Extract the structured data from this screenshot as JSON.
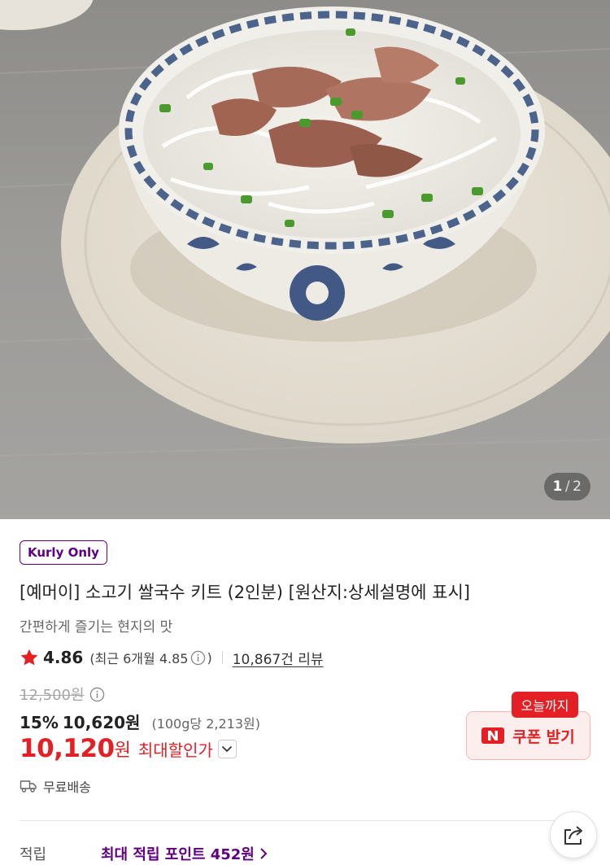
{
  "image_pager": {
    "current": "1",
    "separator": "/",
    "total": "2"
  },
  "product": {
    "badge": "Kurly Only",
    "title": "[예머이] 소고기 쌀국수 키트 (2인분) [원산지:상세설명에 표시]",
    "subtitle": "간편하게 즐기는 현지의 맛"
  },
  "rating": {
    "score": "4.86",
    "recent_prefix": "(최근 6개월 4.85",
    "recent_suffix": ")",
    "review_count": "10,867건 리뷰"
  },
  "price": {
    "original": "12,500원",
    "discount_rate": "15%",
    "sale": "10,620원",
    "unit_price": "(100g당 2,213원)",
    "max_discount": "10,120",
    "max_discount_unit": "원",
    "max_discount_label": "최대할인가"
  },
  "coupon": {
    "tag": "오늘까지",
    "label": "쿠폰 받기"
  },
  "delivery": {
    "label": "무료배송"
  },
  "points": {
    "label": "적립",
    "value": "최대 적립 포인트 452원"
  },
  "colors": {
    "brand_purple": "#5f0080",
    "sale_red": "#e42024",
    "coupon_bg": "#fdeeee"
  },
  "icons": [
    "star-icon",
    "info-icon",
    "chevron-down-icon",
    "naver-icon",
    "truck-icon",
    "chevron-right-icon",
    "share-icon"
  ]
}
